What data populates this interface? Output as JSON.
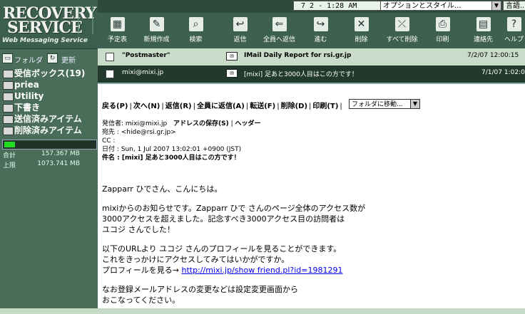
{
  "logo": {
    "line1": "RECOVERY",
    "line2": "SERVICE",
    "tagline": "Web Messaging Service"
  },
  "folderbar": {
    "folder_label": "フォルダ",
    "refresh_label": "更新"
  },
  "folders": [
    {
      "name": "受信ボックス(19)",
      "icon": "inbox-folder-icon"
    },
    {
      "name": "priea",
      "icon": "folder-icon"
    },
    {
      "name": "Utility",
      "icon": "folder-icon"
    },
    {
      "name": "下書き",
      "icon": "draft-icon"
    },
    {
      "name": "送信済みアイテム",
      "icon": "sent-icon"
    },
    {
      "name": "削除済みアイテム",
      "icon": "trash-icon"
    }
  ],
  "usage": {
    "fraction": 0.12,
    "total_label": "合計",
    "total_value": "157.367 MB",
    "limit_label": "上限",
    "limit_value": "1073.741 MB"
  },
  "topbar": {
    "time": "7 2 - 1:28 AM",
    "options_select": "オプションとスタイル...",
    "lang": "言語..."
  },
  "toolbar": [
    {
      "label": "予定表",
      "icon": "calendar-icon",
      "glyph": "▦"
    },
    {
      "label": "新規作成",
      "icon": "new-mail-icon",
      "glyph": "✎"
    },
    {
      "label": "検索",
      "icon": "search-icon",
      "glyph": "⌕"
    },
    {
      "label": "返信",
      "icon": "reply-icon",
      "glyph": "↩"
    },
    {
      "label": "全員へ返信",
      "icon": "reply-all-icon",
      "glyph": "⇐"
    },
    {
      "label": "進む",
      "icon": "forward-icon",
      "glyph": "↪"
    },
    {
      "label": "削除",
      "icon": "delete-icon",
      "glyph": "✕"
    },
    {
      "label": "すべて削除",
      "icon": "delete-all-icon",
      "glyph": "⤫"
    },
    {
      "label": "印刷",
      "icon": "print-icon",
      "glyph": "⎙"
    },
    {
      "label": "連絡先",
      "icon": "contacts-icon",
      "glyph": "▤"
    },
    {
      "label": "ヘルプ",
      "icon": "help-icon",
      "glyph": "?"
    }
  ],
  "messages": [
    {
      "from": "\"Postmaster\"",
      "subject": "IMail Daily Report for rsi.gr.jp",
      "date": "7/2/07 12:00:15"
    },
    {
      "from": "mixi@mixi.jp",
      "subject": "[mixi] 足あと3000人目はこの方です！",
      "date": "7/1/07 1:02:0"
    }
  ],
  "actions": {
    "back": "戻る(P)",
    "next": "次へ(N)",
    "reply": "返信(R)",
    "reply_all": "全員に返信(A)",
    "forward": "転送(F)",
    "delete": "削除(D)",
    "print": "印刷(T)",
    "move_select": "フォルダに移動..."
  },
  "header": {
    "from": "発信者: mixi@mixi.jp",
    "save_address": "アドレスの保存(S)",
    "header_link": "ヘッダー",
    "to": "宛先 : <hide@rsi.gr.jp>",
    "cc": "CC :",
    "date": "日付 : Sun, 1 Jul 2007 13:02:01 +0900 (JST)",
    "subject": "件名 : [mixi] 足あと3000人目はこの方です！"
  },
  "body": {
    "greeting": "Zapparr ひでさん、こんにちは。",
    "p2_l1": "mixiからのお知らせです。Zapparr ひで さんのページ全体のアクセス数が",
    "p2_l2": "3000アクセスを超えました。記念すべき3000アクセス目の訪問者は",
    "p2_l3": "ユコジ さんでした！",
    "p3_l1": "以下のURLより ユコジ さんのプロフィールを見ることができます。",
    "p3_l2": "これをきっかけにアクセスしてみてはいかがですか。",
    "p3_l3_prefix": "プロフィールを見る→ ",
    "profile_url": "http://mixi.jp/show friend.pl?id=1981291",
    "p4_l1": "なお登録メールアドレスの変更などは設定変更画面から",
    "p4_l2": "おこなってください。"
  }
}
